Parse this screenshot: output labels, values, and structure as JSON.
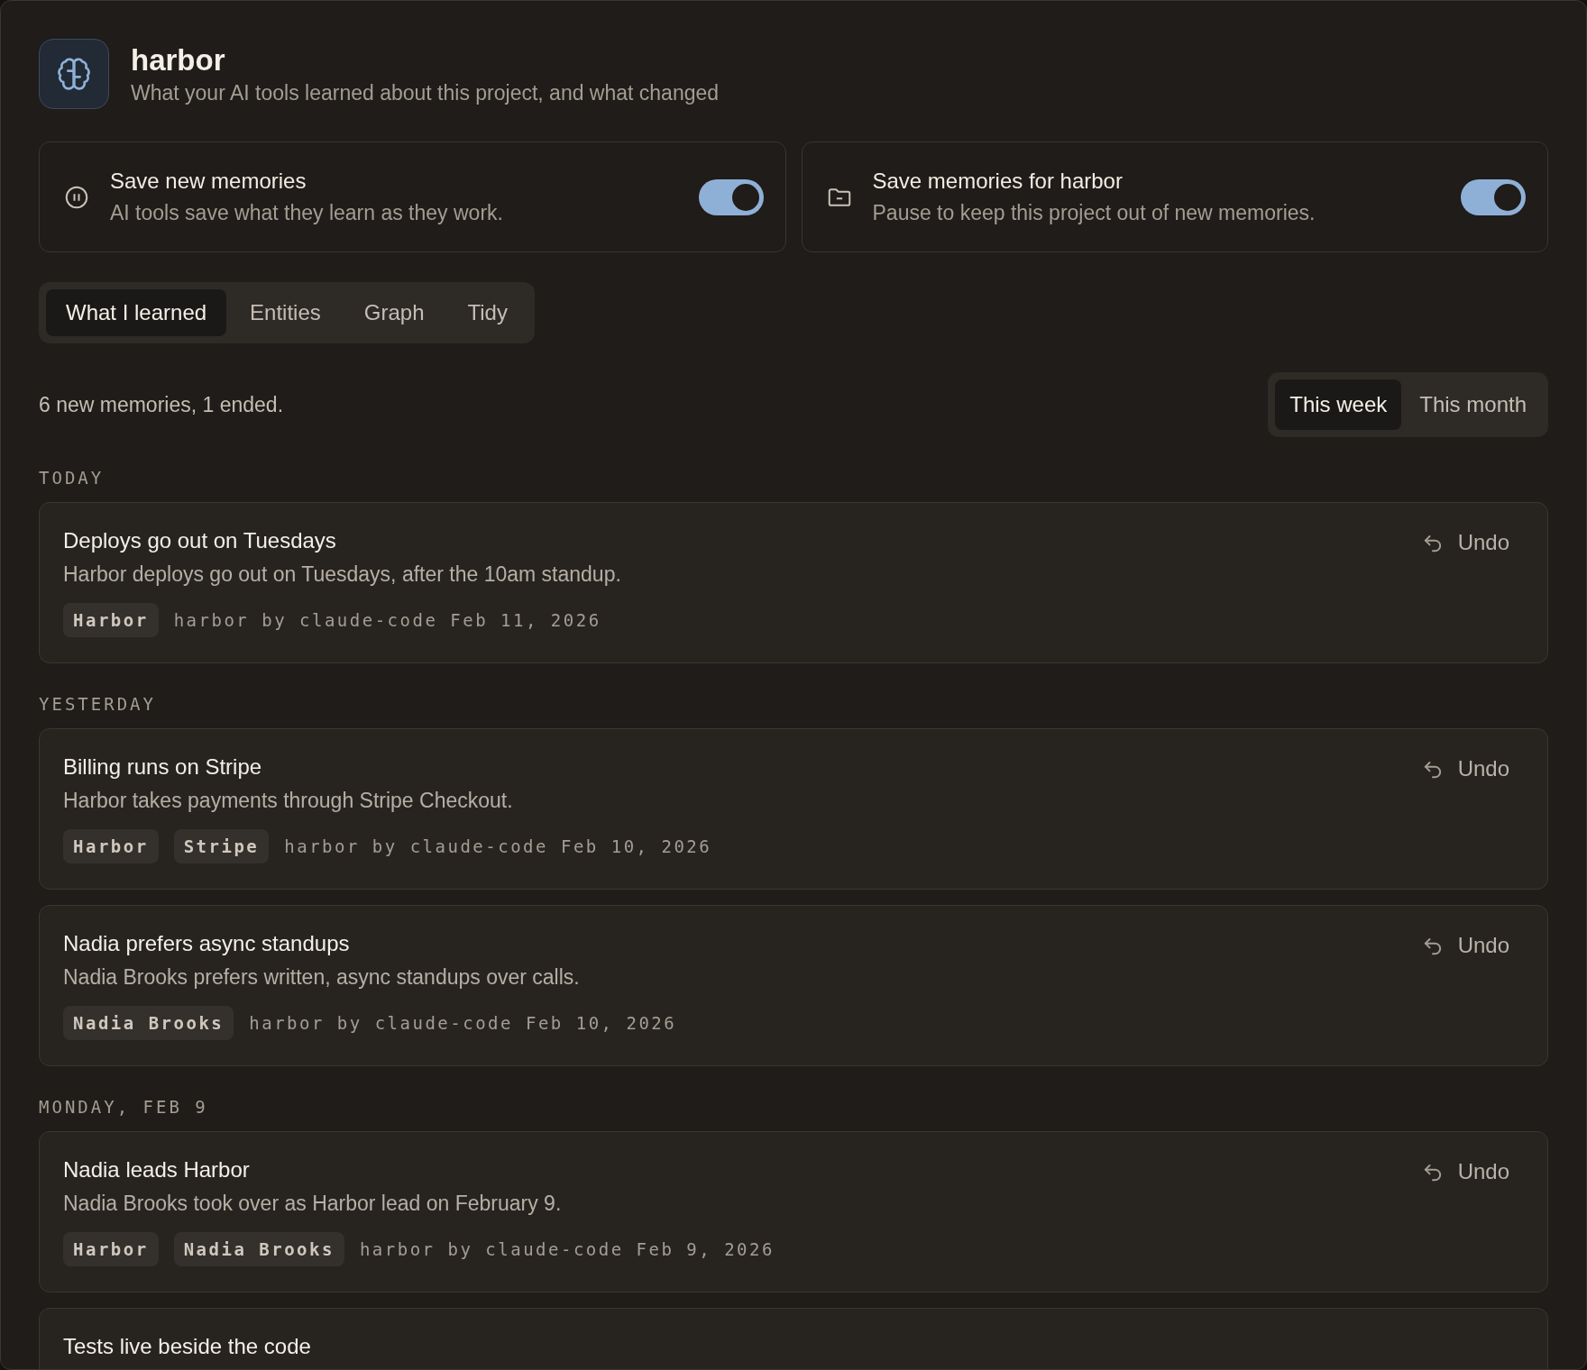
{
  "header": {
    "title": "harbor",
    "subtitle": "What your AI tools learned about this project, and what changed"
  },
  "settings": [
    {
      "kind": "pause",
      "title": "Save new memories",
      "description": "AI tools save what they learn as they work.",
      "on": true
    },
    {
      "kind": "folder",
      "title": "Save memories for harbor",
      "description": "Pause to keep this project out of new memories.",
      "on": true
    }
  ],
  "tabs": [
    {
      "label": "What I learned",
      "selected": true
    },
    {
      "label": "Entities",
      "selected": false
    },
    {
      "label": "Graph",
      "selected": false
    },
    {
      "label": "Tidy",
      "selected": false
    }
  ],
  "summary": "6 new memories, 1 ended.",
  "range": [
    {
      "label": "This week",
      "selected": true
    },
    {
      "label": "This month",
      "selected": false
    }
  ],
  "groups": [
    {
      "label": "TODAY",
      "memories": [
        {
          "title": "Deploys go out on Tuesdays",
          "text": "Harbor deploys go out on Tuesdays, after the 10am standup.",
          "tags": [
            "Harbor"
          ],
          "meta": "harbor by claude-code Feb 11, 2026",
          "action": "Undo"
        }
      ]
    },
    {
      "label": "YESTERDAY",
      "memories": [
        {
          "title": "Billing runs on Stripe",
          "text": "Harbor takes payments through Stripe Checkout.",
          "tags": [
            "Harbor",
            "Stripe"
          ],
          "meta": "harbor by claude-code Feb 10, 2026",
          "action": "Undo"
        },
        {
          "title": "Nadia prefers async standups",
          "text": "Nadia Brooks prefers written, async standups over calls.",
          "tags": [
            "Nadia Brooks"
          ],
          "meta": "harbor by claude-code Feb 10, 2026",
          "action": "Undo"
        }
      ]
    },
    {
      "label": "MONDAY, FEB 9",
      "memories": [
        {
          "title": "Nadia leads Harbor",
          "text": "Nadia Brooks took over as Harbor lead on February 9.",
          "tags": [
            "Harbor",
            "Nadia Brooks"
          ],
          "meta": "harbor by claude-code Feb 9, 2026",
          "action": "Undo"
        },
        {
          "title": "Tests live beside the code"
        }
      ]
    }
  ]
}
